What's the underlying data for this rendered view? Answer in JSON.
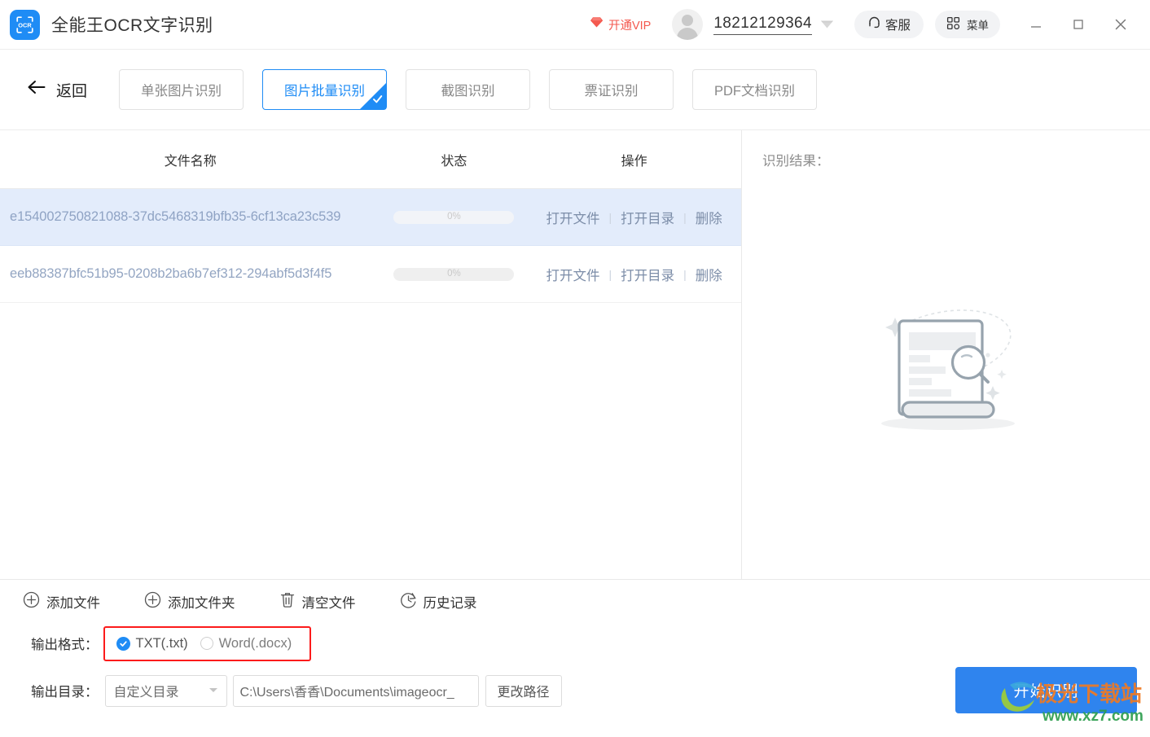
{
  "titlebar": {
    "app_name": "全能王OCR文字识别",
    "logo_text": "OCR",
    "vip_label": "开通VIP",
    "phone": "18212129364",
    "support_label": "客服",
    "menu_label": "菜单",
    "minimize_label": "−",
    "maximize_label": "□",
    "close_label": "×",
    "accent_color": "#1f8cf5",
    "vip_color": "#f4594f"
  },
  "tabbar": {
    "back_label": "返回",
    "tabs": [
      {
        "label": "单张图片识别",
        "active": false
      },
      {
        "label": "图片批量识别",
        "active": true
      },
      {
        "label": "截图识别",
        "active": false
      },
      {
        "label": "票证识别",
        "active": false
      },
      {
        "label": "PDF文档识别",
        "active": false
      }
    ]
  },
  "file_table": {
    "columns": [
      "文件名称",
      "状态",
      "操作"
    ],
    "ops": [
      "打开文件",
      "打开目录",
      "删除"
    ],
    "rows": [
      {
        "filename": "e154002750821088-37dc5468319bfb35-6cf13ca23c539",
        "progress": "0%",
        "selected": true
      },
      {
        "filename": "eeb88387bfc51b95-0208b2ba6b7ef312-294abf5d3f4f5",
        "progress": "0%",
        "selected": false
      }
    ]
  },
  "result_panel": {
    "title": "识别结果：",
    "placeholder_illustration": "document-search-illustration"
  },
  "toolbar": {
    "actions": [
      {
        "label": "添加文件",
        "icon": "plus-circle-icon"
      },
      {
        "label": "添加文件夹",
        "icon": "plus-circle-icon"
      },
      {
        "label": "清空文件",
        "icon": "trash-icon"
      },
      {
        "label": "历史记录",
        "icon": "history-clock-icon"
      }
    ]
  },
  "output_format": {
    "label": "输出格式：",
    "options": [
      {
        "label": "TXT(.txt)",
        "selected": true
      },
      {
        "label": "Word(.docx)",
        "selected": false
      }
    ],
    "highlight_color": "#fc1b1b"
  },
  "output_dir": {
    "label": "输出目录：",
    "mode_value": "自定义目录",
    "path_value": "C:\\Users\\香香\\Documents\\imageocr_",
    "change_path_label": "更改路径"
  },
  "start_button": {
    "label": "开始识别",
    "color": "#2f84ee"
  },
  "watermark": {
    "text": "极光下载站",
    "url": "www.xz7.com"
  }
}
